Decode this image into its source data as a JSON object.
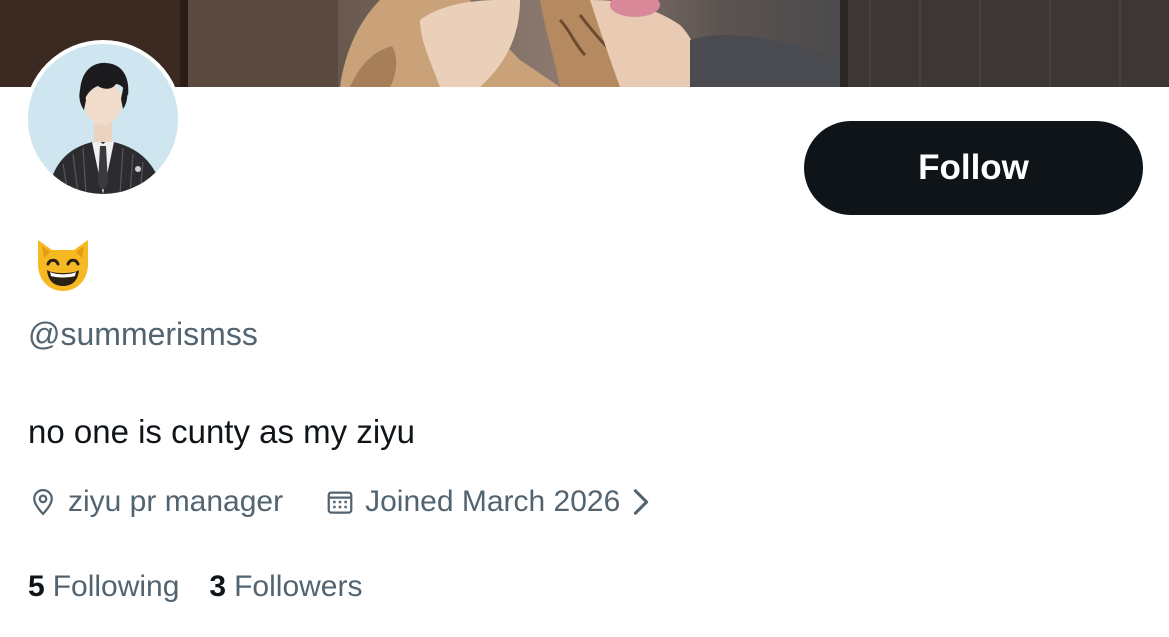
{
  "profile": {
    "display_name_emoji": "😸",
    "handle": "@summerismss",
    "bio": "no one is cunty as my ziyu",
    "location": "ziyu pr manager",
    "joined": "Joined March 2026",
    "follow_label": "Follow"
  },
  "stats": {
    "following_count": "5",
    "following_label": "Following",
    "followers_count": "3",
    "followers_label": "Followers"
  },
  "icons": {
    "location": "location-pin-icon",
    "calendar": "calendar-icon",
    "chevron": "chevron-right-icon"
  },
  "colors": {
    "primary_text": "#0f1419",
    "secondary_text": "#536471",
    "button_bg": "#0f1419",
    "button_text": "#ffffff"
  }
}
